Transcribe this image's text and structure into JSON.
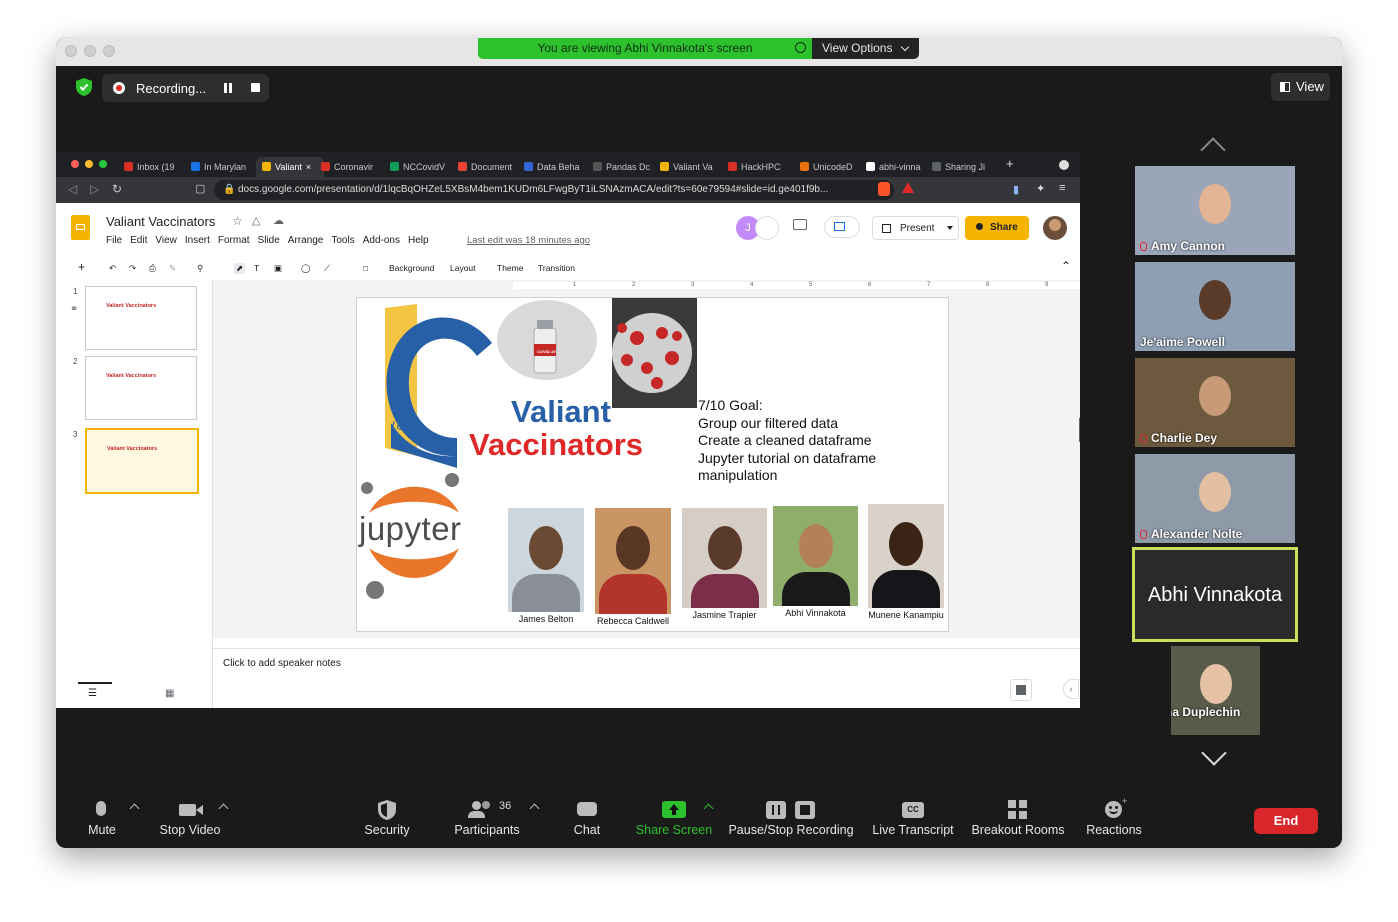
{
  "banner": {
    "text": "You are viewing Abhi Vinnakota's screen",
    "options_label": "View Options"
  },
  "recording": {
    "label": "Recording..."
  },
  "view_button": {
    "label": "View"
  },
  "browser": {
    "tabs": [
      {
        "label": "Inbox (19",
        "color": "#d93025"
      },
      {
        "label": "In Marylan",
        "color": "#1a73e8"
      },
      {
        "label": "Valiant",
        "color": "#f4b400"
      },
      {
        "label": "Coronavir",
        "color": "#d93025"
      },
      {
        "label": "NCCovidV",
        "color": "#0f9d58"
      },
      {
        "label": "Document",
        "color": "#ea4335"
      },
      {
        "label": "Data Beha",
        "color": "#3367d6"
      },
      {
        "label": "Pandas Dc",
        "color": "#555555"
      },
      {
        "label": "Valiant Va",
        "color": "#f4b400"
      },
      {
        "label": "HackHPC",
        "color": "#d93025"
      },
      {
        "label": "UnicodeD",
        "color": "#e8710a"
      },
      {
        "label": "abhi-vinna",
        "color": "#ffffff"
      },
      {
        "label": "Sharing Ji",
        "color": "#5f6368"
      }
    ],
    "url": "docs.google.com/presentation/d/1lqcBqOHZeL5XBsM4bem1KUDm6LFwgByT1iLSNAzmACA/edit?ts=60e79594#slide=id.ge401f9b..."
  },
  "slides": {
    "title": "Valiant Vaccinators",
    "menu": [
      "File",
      "Edit",
      "View",
      "Insert",
      "Format",
      "Slide",
      "Arrange",
      "Tools",
      "Add-ons",
      "Help"
    ],
    "last_edit": "Last edit was 18 minutes ago",
    "present_label": "Present",
    "share_label": "Share",
    "avatar_initial": "J",
    "toolbar": {
      "background": "Background",
      "layout": "Layout",
      "theme": "Theme",
      "transition": "Transition"
    },
    "thumb_numbers": [
      "1",
      "2",
      "3"
    ],
    "thumb_title": "Valiant Vaccinators",
    "ruler_ticks": [
      "1",
      "2",
      "3",
      "4",
      "5",
      "6",
      "7",
      "8",
      "9"
    ],
    "speaker_notes_placeholder": "Click to add speaker notes",
    "slide": {
      "heading_line1": "Valiant",
      "heading_line2": "Vaccinators",
      "badge_text": "I CHOOSE",
      "vial_label": "COVID-19",
      "goal_title": "7/10 Goal:",
      "goals": [
        "Group our filtered data",
        "Create a cleaned dataframe",
        "Jupyter tutorial on dataframe",
        "manipulation"
      ],
      "jupyter_label": "jupyter",
      "people": [
        {
          "name": "James Belton",
          "shirt": "#8a8f96",
          "skin": "#6b4a33",
          "bg": "#cdd6dd"
        },
        {
          "name": "Rebecca Caldwell",
          "shirt": "#b3342b",
          "skin": "#5a3724",
          "bg": "#c99565"
        },
        {
          "name": "Jasmine Trapier",
          "shirt": "#7a2e4a",
          "skin": "#5a3a2a",
          "bg": "#d6cdc7"
        },
        {
          "name": "Abhi Vinnakota",
          "shirt": "#1a1a1a",
          "skin": "#b4805a",
          "bg": "#8fae6a"
        },
        {
          "name": "Munene Kanampiu",
          "shirt": "#15151a",
          "skin": "#3b2416",
          "bg": "#d8d2c8"
        }
      ]
    }
  },
  "participants_panel": [
    {
      "name": "Amy Cannon",
      "muted": true
    },
    {
      "name": "Je'aime Powell",
      "muted": false
    },
    {
      "name": "Charlie Dey",
      "muted": true
    },
    {
      "name": "Alexander Nolte",
      "muted": true
    },
    {
      "name": "Abhi Vinnakota",
      "muted": false
    },
    {
      "name": "Lena Duplechin S...",
      "muted": true
    }
  ],
  "controls": {
    "mute": "Mute",
    "stop_video": "Stop Video",
    "security": "Security",
    "participants": "Participants",
    "participants_count": "36",
    "chat": "Chat",
    "share_screen": "Share Screen",
    "pause_stop_recording": "Pause/Stop Recording",
    "live_transcript": "Live Transcript",
    "cc_label": "CC",
    "breakout_rooms": "Breakout Rooms",
    "reactions": "Reactions",
    "end": "End"
  },
  "colors": {
    "share_green": "#2cc12d",
    "end_red": "#d9262b",
    "active_speaker": "#c8e05a",
    "slide_blue": "#2860a8",
    "slide_red": "#e02828"
  }
}
